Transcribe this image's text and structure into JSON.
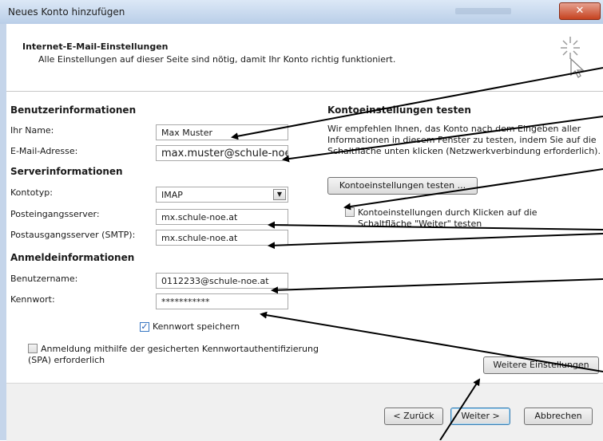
{
  "window": {
    "title": "Neues Konto hinzufügen",
    "close_glyph": "✕"
  },
  "header": {
    "title": "Internet-E-Mail-Einstellungen",
    "subtitle": "Alle Einstellungen auf dieser Seite sind nötig, damit Ihr Konto richtig funktioniert.",
    "icon": "cursor-click-icon"
  },
  "user_info": {
    "heading": "Benutzerinformationen",
    "name_label": "Ihr Name:",
    "name_value": "Max Muster",
    "email_label": "E-Mail-Adresse:",
    "email_value": "max.muster@schule-noe."
  },
  "server_info": {
    "heading": "Serverinformationen",
    "type_label": "Kontotyp:",
    "type_value": "IMAP",
    "incoming_label": "Posteingangsserver:",
    "incoming_value": "mx.schule-noe.at",
    "outgoing_label": "Postausgangsserver (SMTP):",
    "outgoing_value": "mx.schule-noe.at"
  },
  "login_info": {
    "heading": "Anmeldeinformationen",
    "username_label": "Benutzername:",
    "username_value": "0112233@schule-noe.at",
    "password_label": "Kennwort:",
    "password_value": "***********",
    "save_password_label": "Kennwort speichern",
    "save_password_checked": true,
    "spa_label_line1": "Anmeldung mithilfe der gesicherten Kennwortauthentifizierung",
    "spa_label_line2": "(SPA) erforderlich",
    "spa_checked": false
  },
  "test": {
    "heading": "Kontoeinstellungen testen",
    "desc_line1": "Wir empfehlen Ihnen, das Konto nach dem Eingeben aller",
    "desc_line2": "Informationen in diesem Fenster zu testen, indem Sie auf die",
    "desc_line3": "Schaltfläche unten klicken (Netzwerkverbindung erforderlich).",
    "test_button": "Kontoeinstellungen testen ...",
    "auto_test_line1": "Kontoeinstellungen durch Klicken auf die",
    "auto_test_line2": "Schaltfläche \"Weiter\" testen",
    "auto_test_checked": false
  },
  "more_settings_button": "Weitere Einstellungen",
  "footer": {
    "back": "< Zurück",
    "next": "Weiter >",
    "cancel": "Abbrechen"
  },
  "colors": {
    "annotation_arrow": "#000000",
    "titlebar": "#c5d5ea",
    "close_button": "#c6421f"
  }
}
